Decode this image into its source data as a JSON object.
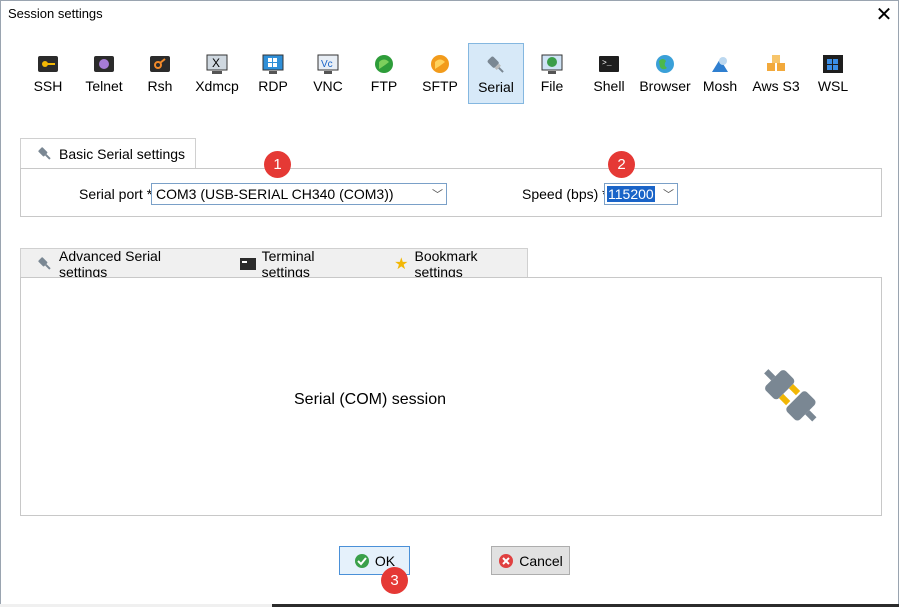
{
  "window": {
    "title": "Session settings"
  },
  "toolbar": {
    "items": [
      {
        "label": "SSH",
        "icon": "key-icon"
      },
      {
        "label": "Telnet",
        "icon": "telnet-icon"
      },
      {
        "label": "Rsh",
        "icon": "rsh-icon"
      },
      {
        "label": "Xdmcp",
        "icon": "xdmcp-icon"
      },
      {
        "label": "RDP",
        "icon": "rdp-icon"
      },
      {
        "label": "VNC",
        "icon": "vnc-icon"
      },
      {
        "label": "FTP",
        "icon": "ftp-icon"
      },
      {
        "label": "SFTP",
        "icon": "sftp-icon"
      },
      {
        "label": "Serial",
        "icon": "serial-plug-icon",
        "active": true
      },
      {
        "label": "File",
        "icon": "file-icon"
      },
      {
        "label": "Shell",
        "icon": "shell-icon"
      },
      {
        "label": "Browser",
        "icon": "browser-globe-icon"
      },
      {
        "label": "Mosh",
        "icon": "mosh-icon"
      },
      {
        "label": "Aws S3",
        "icon": "aws-s3-icon"
      },
      {
        "label": "WSL",
        "icon": "wsl-icon"
      }
    ]
  },
  "basic": {
    "tab_label": "Basic Serial settings",
    "port_label": "Serial port *",
    "port_value": "COM3  (USB-SERIAL CH340 (COM3))",
    "speed_label": "Speed (bps) *",
    "speed_value": "115200"
  },
  "tabs": [
    {
      "label": "Advanced Serial settings",
      "icon": "serial-plug-icon"
    },
    {
      "label": "Terminal settings",
      "icon": "terminal-icon"
    },
    {
      "label": "Bookmark settings",
      "icon": "star-icon"
    }
  ],
  "main": {
    "session_text": "Serial (COM) session"
  },
  "buttons": {
    "ok": "OK",
    "cancel": "Cancel"
  },
  "badges": [
    "1",
    "2",
    "3"
  ],
  "colors": {
    "accent": "#1a64c8",
    "badge": "#e53935",
    "active_tool": "#d7e9f8"
  }
}
